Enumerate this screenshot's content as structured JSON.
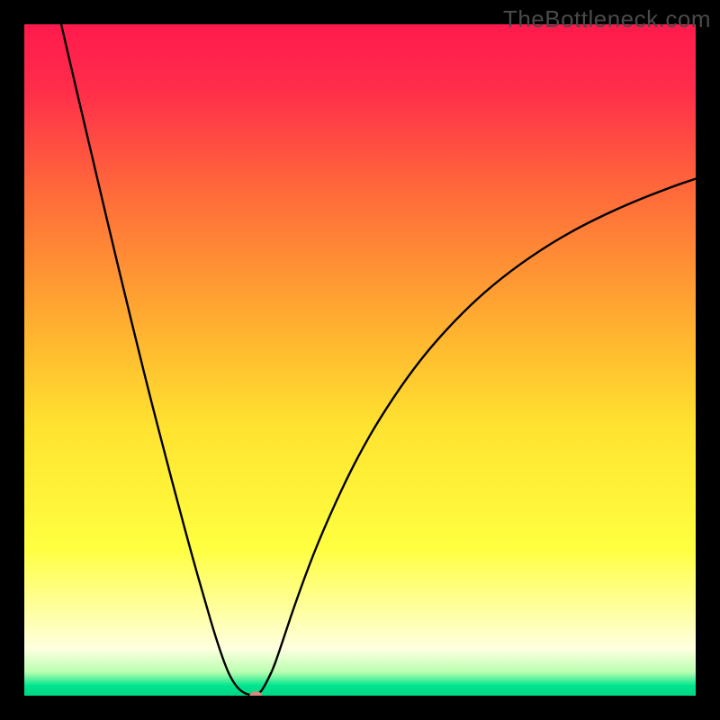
{
  "watermark": "TheBottleneck.com",
  "chart_data": {
    "type": "line",
    "title": "",
    "xlabel": "",
    "ylabel": "",
    "xlim": [
      0,
      100
    ],
    "ylim": [
      0,
      100
    ],
    "grid": false,
    "background_gradient_stops": [
      {
        "pos": 0.0,
        "color": "#ff1a4d"
      },
      {
        "pos": 0.1,
        "color": "#ff2e4a"
      },
      {
        "pos": 0.25,
        "color": "#ff6a3a"
      },
      {
        "pos": 0.45,
        "color": "#ffb030"
      },
      {
        "pos": 0.6,
        "color": "#ffe330"
      },
      {
        "pos": 0.78,
        "color": "#ffff40"
      },
      {
        "pos": 0.88,
        "color": "#ffffa8"
      },
      {
        "pos": 0.93,
        "color": "#ffffe0"
      },
      {
        "pos": 0.965,
        "color": "#b8ffb0"
      },
      {
        "pos": 0.985,
        "color": "#00e58e"
      },
      {
        "pos": 1.0,
        "color": "#00d486"
      }
    ],
    "series": [
      {
        "name": "bottleneck-curve",
        "color": "#000000",
        "x": [
          5.5,
          7,
          9,
          11,
          13,
          15,
          17,
          19,
          21,
          23,
          25,
          27,
          28.5,
          30,
          31,
          32,
          33,
          34,
          34.8,
          35.5,
          37,
          38,
          39,
          40,
          42,
          44,
          47,
          50,
          53,
          57,
          61,
          66,
          71,
          77,
          83,
          90,
          97,
          100
        ],
        "y": [
          100,
          93.5,
          85,
          76.5,
          68,
          59.7,
          51.5,
          43.5,
          35.8,
          28.2,
          20.8,
          13.8,
          8.7,
          4.3,
          2.2,
          0.9,
          0.25,
          0.05,
          0.2,
          0.9,
          3.8,
          6.7,
          9.7,
          12.7,
          18.3,
          23.4,
          30.2,
          36.2,
          41.4,
          47.4,
          52.5,
          57.8,
          62.2,
          66.5,
          70.0,
          73.3,
          76.0,
          77.0
        ]
      }
    ],
    "marker": {
      "name": "optimal-point",
      "x": 34.5,
      "y": 0,
      "rx": 0.95,
      "ry": 0.65,
      "color": "#d58a7a"
    }
  }
}
